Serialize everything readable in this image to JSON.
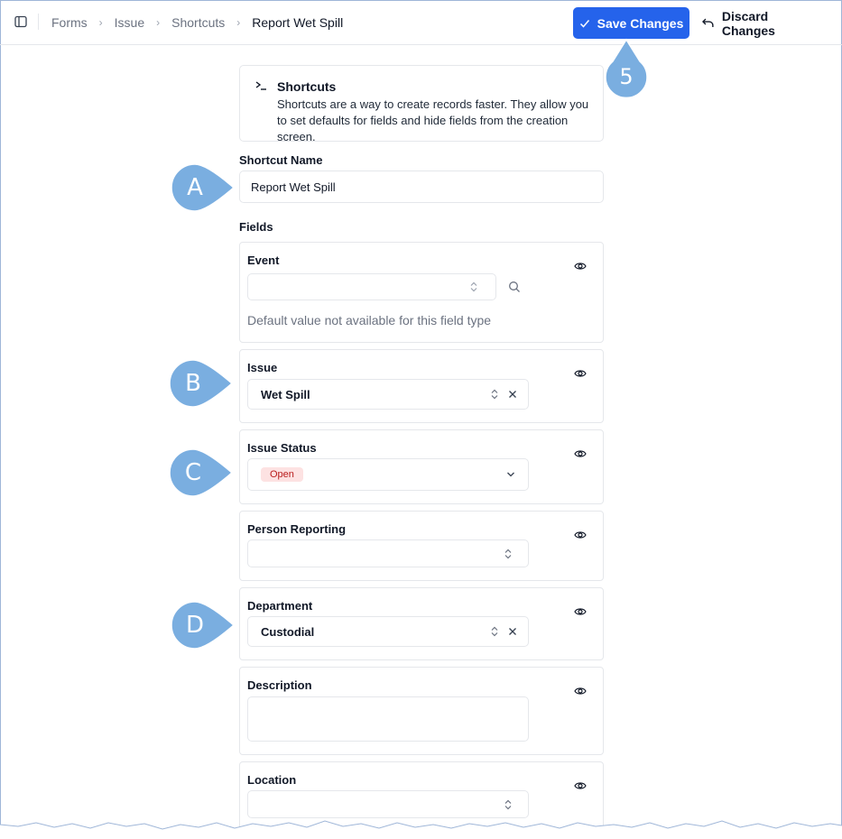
{
  "breadcrumb": [
    "Forms",
    "Issue",
    "Shortcuts",
    "Report Wet Spill"
  ],
  "actions": {
    "save_label": "Save Changes",
    "discard_label": "Discard Changes"
  },
  "info": {
    "title": "Shortcuts",
    "text": "Shortcuts are a way to create records faster. They allow you to set defaults for fields and hide fields from the creation screen."
  },
  "shortcut_name": {
    "label": "Shortcut Name",
    "value": "Report Wet Spill"
  },
  "fields_label": "Fields",
  "fields": {
    "event": {
      "label": "Event",
      "value": "",
      "note": "Default value not available for this field type"
    },
    "issue": {
      "label": "Issue",
      "value": "Wet Spill"
    },
    "issue_status": {
      "label": "Issue Status",
      "value": "Open"
    },
    "person_reporting": {
      "label": "Person Reporting",
      "value": ""
    },
    "department": {
      "label": "Department",
      "value": "Custodial"
    },
    "description": {
      "label": "Description",
      "value": ""
    },
    "location": {
      "label": "Location",
      "value": ""
    }
  },
  "callouts": {
    "step": "5",
    "a": "A",
    "b": "B",
    "c": "C",
    "d": "D"
  },
  "colors": {
    "primary": "#2563eb",
    "callout": "#7aaee0",
    "badge_bg": "#fde2e2",
    "badge_text": "#b91c1c"
  }
}
